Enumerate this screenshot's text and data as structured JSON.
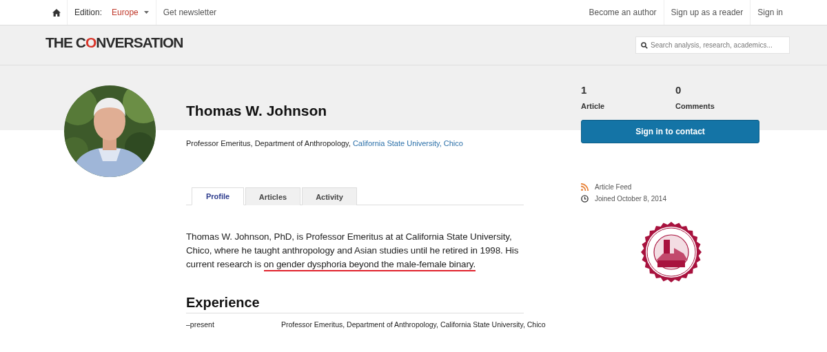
{
  "top_nav": {
    "edition_label": "Edition:",
    "edition_value": "Europe",
    "left_links": [
      "Get newsletter"
    ],
    "right_links": [
      "Become an author",
      "Sign up as a reader",
      "Sign in"
    ]
  },
  "header": {
    "logo_parts": [
      "THE C",
      "O",
      "NVERSATION"
    ],
    "search": {
      "placeholder": "Search analysis, research, academics..."
    }
  },
  "profile": {
    "name": "Thomas W. Johnson",
    "affiliation": {
      "text": "Professor Emeritus, Department of Anthropology, ",
      "link": "California State University, Chico"
    },
    "tabs": [
      {
        "label": "Profile",
        "selected": true
      },
      {
        "label": "Articles",
        "selected": false
      },
      {
        "label": "Activity",
        "selected": false
      }
    ],
    "bio": {
      "text": "Thomas W. Johnson, PhD, is Professor Emeritus at at California State University, Chico, where he taught anthropology and Asian studies until he retired in 1998. His current research is ",
      "underlined": "on gender dysphoria beyond the male-female binary."
    },
    "experience": {
      "heading": "Experience",
      "rows": [
        {
          "period": "–present",
          "role": "Professor Emeritus, Department of Anthropology, California State University, Chico"
        }
      ]
    }
  },
  "sidebar": {
    "stats": [
      {
        "value": "1",
        "label": "Article"
      },
      {
        "value": "0",
        "label": "Comments"
      }
    ],
    "contact_button": "Sign in to contact",
    "links": [
      {
        "kind": "feed",
        "label": "Article Feed"
      },
      {
        "kind": "joined",
        "label": "Joined October 8, 2014"
      }
    ]
  }
}
